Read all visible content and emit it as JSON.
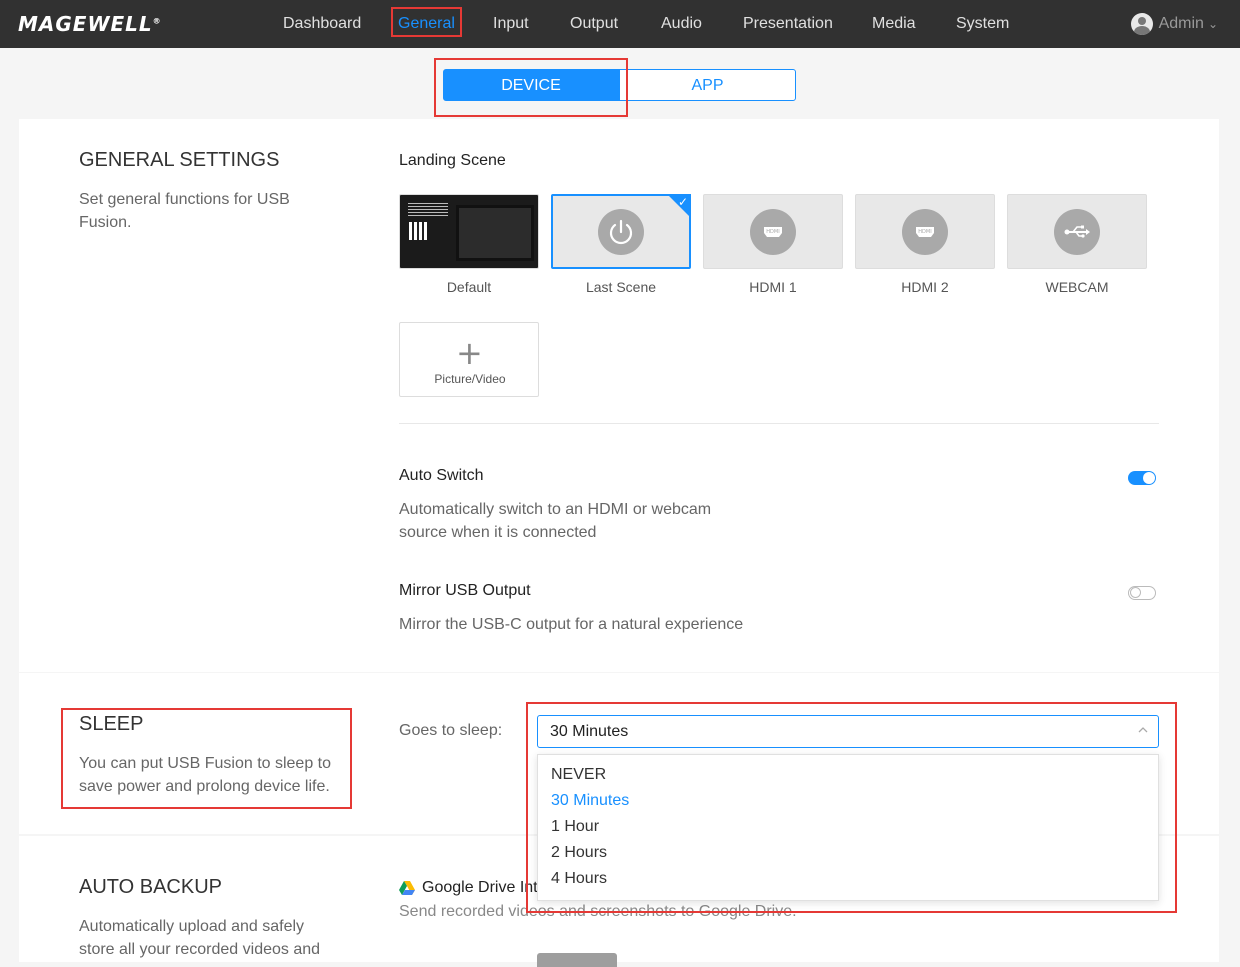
{
  "header": {
    "logo": "MAGEWELL",
    "logo_mark": "®",
    "nav": [
      "Dashboard",
      "General",
      "Input",
      "Output",
      "Audio",
      "Presentation",
      "Media",
      "System"
    ],
    "active_nav": "General",
    "user": "Admin",
    "user_chevron": "⌄"
  },
  "tabs": {
    "device": "DEVICE",
    "app": "APP",
    "active": "DEVICE"
  },
  "general": {
    "title": "GENERAL SETTINGS",
    "description": "Set general functions for USB Fusion.",
    "landing_scene": {
      "label": "Landing Scene",
      "selected": "Last Scene",
      "scenes": [
        {
          "label": "Default",
          "icon": "default-thumbnail"
        },
        {
          "label": "Last Scene",
          "icon": "power-icon"
        },
        {
          "label": "HDMI 1",
          "icon": "hdmi-icon"
        },
        {
          "label": "HDMI 2",
          "icon": "hdmi-icon"
        },
        {
          "label": "WEBCAM",
          "icon": "usb-icon"
        }
      ],
      "add_label": "Picture/Video",
      "add_icon": "plus-icon"
    },
    "auto_switch": {
      "title": "Auto Switch",
      "description": "Automatically switch to an HDMI or webcam source when it is connected",
      "enabled": true
    },
    "mirror": {
      "title": "Mirror USB Output",
      "description": "Mirror the USB-C output for a natural experience",
      "enabled": false
    }
  },
  "sleep": {
    "title": "SLEEP",
    "description": "You can put USB Fusion to sleep to save power and prolong device life.",
    "label": "Goes to sleep:",
    "selected": "30 Minutes",
    "options": [
      "NEVER",
      "30 Minutes",
      "1 Hour",
      "2 Hours",
      "4 Hours"
    ]
  },
  "auto_backup": {
    "title": "AUTO BACKUP",
    "description": "Automatically upload and safely store all your recorded videos and",
    "google_drive_label": "Google Drive Int",
    "google_drive_desc": "Send recorded videos and screenshots to Google Drive."
  },
  "colors": {
    "accent": "#1890ff",
    "topbar": "#313131",
    "highlight": "#e53935"
  }
}
